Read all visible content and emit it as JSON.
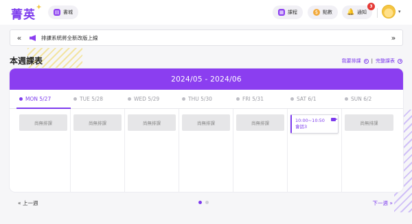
{
  "header": {
    "logo": "菁英",
    "book_label": "書城",
    "course_label": "課程",
    "points_label": "點數",
    "notify_label": "通知",
    "notify_count": "3"
  },
  "announcement": {
    "text": "排課系統將全新改版上線",
    "prev": "«",
    "next": "»"
  },
  "section": {
    "title": "本週課表",
    "link_schedule": "我要排課",
    "link_full": "完整課表",
    "separator": "|"
  },
  "calendar": {
    "range": "2024/05 - 2024/06",
    "days": [
      {
        "label": "MON 5/27",
        "empty": "尚無排課"
      },
      {
        "label": "TUE 5/28",
        "empty": "尚無排課"
      },
      {
        "label": "WED 5/29",
        "empty": "尚無排課"
      },
      {
        "label": "THU 5/30",
        "empty": "尚無排課"
      },
      {
        "label": "FRI 5/31",
        "empty": "尚無排課"
      },
      {
        "label": "SAT 6/1",
        "lesson_time": "10:00~10:50",
        "lesson_name": "會話3"
      },
      {
        "label": "SUN 6/2",
        "empty": "尚無排課"
      }
    ]
  },
  "pager": {
    "prev": "« 上一週",
    "next": "下一週 »"
  },
  "colors": {
    "accent": "#8b3ef0",
    "gold": "#f2c94c"
  }
}
